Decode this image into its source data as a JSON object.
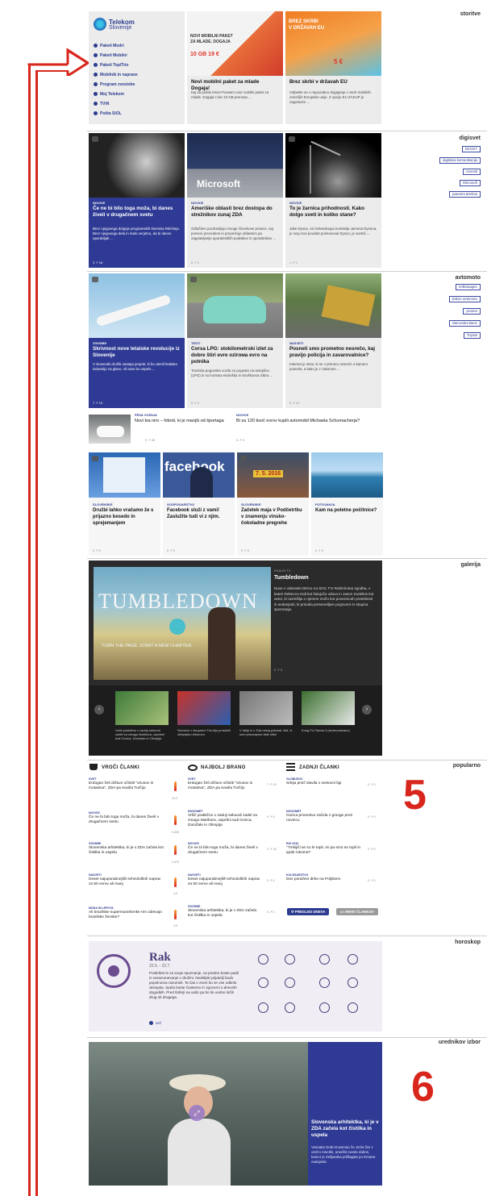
{
  "sections": {
    "storitve": "storitve",
    "digisvet": "digisvet",
    "avtomoto": "avtomoto",
    "galerija": "galerija",
    "popularno": "popularno",
    "horoskop": "horoskop",
    "urednikov": "urednikov izbor"
  },
  "telekom": {
    "brand1": "Telekom",
    "brand2": "Slovenije",
    "items": [
      "Paketi Modri",
      "Paketi Mobilni",
      "Paketi Top/Trio",
      "Mobilnik in naprave",
      "Program zvestobe",
      "Moj Telekom",
      "TViN",
      "Pošta SiOL"
    ]
  },
  "storitve_cards": [
    {
      "title": "Novi mobilni paket za mlade Dogaja!",
      "text": "Kaj sa pošite letos! Povsem novi mobilni paket za mlade. Dogaja s kar 10 GB prenosa ..."
    },
    {
      "title": "Brez skrbi v državah EU",
      "text": "Vsjbetite se v nepozabno dogajanje v vseh mobilnih omrežjih Evropske unije. Z opcijo EU ZAKUP je zagotovite ..."
    }
  ],
  "promo1": {
    "line1": "NOVI MOBILNI PAKET",
    "line2": "ZA MLADE. DOGAJA",
    "price": "10 GB 19 €"
  },
  "promo2": {
    "line1": "BREZ SKRBI",
    "line2": "V DRŽAVAH EU",
    "price": "5 €"
  },
  "digisvet_cards": [
    {
      "tag": "NOVICE",
      "title": "Če ne bi bilo toga moža, bi danes živeli v drugačnem svetu",
      "text": "Brez njegovega dolgoje programskih Dennisa Ritchieja. Brez njegovega dela in malo verjetno, da bi danes uporabljali ...",
      "stats": "3  ↗ 18"
    },
    {
      "tag": "NOVICE",
      "title": "Ameriške oblasti brez dostopa do strežnikov zunaj ZDA",
      "text": "Odločitev pozdravljajo mnoge človekove pravice, saj pomeni precedens in preprečuje oblastem pa zagotavljanje uporabniških podatkov iz uporabnikov ...",
      "stats": "0  ↗ 1"
    },
    {
      "tag": "NOVICE",
      "title": "To je žarnica prihodnosti. Kako dolgo sveti in koliko stane?",
      "text": "Jake Dyson, sin britanskega izumitelja Jamesa Dysona, je svoj novi produkt poimenoval Dyson, je svetnil ...",
      "stats": "1  ↗ 1"
    }
  ],
  "digisvet_tags": [
    "DIGGIT",
    "digitalna komunikacija",
    "novosti",
    "Microsoft",
    "pametni telefoni"
  ],
  "avtomoto_cards": [
    {
      "tag": "ZGODBE",
      "title": "Skrivnost nove letalske revolucije iz Slovenije",
      "text": "V slovenski družbi nastaja projekt, ki bo obrnil letalsko industrijo na glavo. Ali nam bo uspelo ...",
      "stats": "7  ↗ 13"
    },
    {
      "tag": "TESTI",
      "title": "Corsa LPG: stokilometrski izlet za dobre štiri evre ozirома evro na potnika",
      "text": "Tovrstna pogonska vozila so pogosto na avtoplinu (LPG) in so koristna ekološka in stroškovna izbira ...",
      "stats": "0  ↗ 4"
    },
    {
      "tag": "NASVETI",
      "title": "Posneli smo prometno nesrečo, kaj pravijo policija in zavarovalnice?",
      "text": "Internet je stvar, ki se v primeru nesreče s kamero posnela, a kako je z zakonom ...",
      "stats": "0  ↗ 10"
    }
  ],
  "avtomoto_tags": [
    "Volkswagen",
    "Zakon avtomoto",
    "promet",
    "Mercedes-Benz",
    "Toyota"
  ],
  "small_news": [
    {
      "tag": "PRVA VOŽNJA",
      "title": "Novi kia niro – hibrid, ki je manjši od športaga",
      "stats": "0  ↗ 45"
    },
    {
      "tag": "NOVICE",
      "title": "Bi za 120 tisoč evrov kupili avtomobil Michaela Schumacherja?",
      "stats": "0  ↗ 0"
    }
  ],
  "four_cards": [
    {
      "tag": "SLOVENSKE",
      "title": "Družbi lahko vračamo že s prijazno besedo in sprejemanjem",
      "stats": "0  ↗ 0"
    },
    {
      "tag": "GOSPODARSTVO",
      "title": "Facebook služi z vami! Zaslužite tudi vi z njim.",
      "stats": "0  ↗ 0"
    },
    {
      "tag": "SLOVENSKE",
      "title": "Začetek maja v Podčetrtku v znamenju vinsko-čokoladne pregrehe",
      "stats": "0  ↗ 0"
    },
    {
      "tag": "POTOVANJA",
      "title": "Kam na poletne počitnice?",
      "stats": "0  ↗ 0"
    }
  ],
  "card4_imgtext": "facebook",
  "card3_imgtext": "7. 5. 2016",
  "gallery": {
    "big_text": "TUMBLEDOWN",
    "sub": "TURN THE PAGE. START A NEW CHAPTER.",
    "tag": "FILM IN TV",
    "title": "Tumbledown",
    "text": "Nove v videoteki DKino na SiOL TV! Rahločutna zgodba, v kateri Rebecca Hall kot žalujoča vdova in Jason Sudeikis kot avtor, ki razmišlja o njenem možu kot poveznicah preteklosti in sedanjosti, ki prinaša presenetljive pogovore in skupna spoznanja.",
    "stats": "0  ↗ 0",
    "thumbs": [
      "Vršič praktično v zadnji sekundi zadel za zmago Maribora, uspešni tudi Gorica, Domžale in Olimpija",
      "Slovenci v skupnem Turnirju prosistili olimpijsko tekmovo",
      "V Italiji in v Zda nekaj policisti, tisti, ki smo pravzaprav tiste slike",
      "Kung Fu Panda 3 (sinhronizirano)"
    ]
  },
  "popular": {
    "col1_title": "VROČI ČLANKI",
    "col2_title": "NAJBOLJ BRANO",
    "col3_title": "ZADNJI ČLANKI",
    "big_number": "5",
    "col1": [
      {
        "tag": "SVET",
        "text": "Erdogan želi državo očistiti \"virusov in motastva\", ZDA pa svarila Turčijo",
        "n": "10.2"
      },
      {
        "tag": "NOVICE",
        "text": "Če ne bi bilo toga moža, bi danes živeli v drugačnem svetu",
        "n": "4,426"
      },
      {
        "tag": "ZGODBE",
        "text": "Slovenska arhitektka, ki je v ZDA začela kot čistilka in uspela",
        "n": "3,375"
      },
      {
        "tag": "NASVETI",
        "text": "Deset najuporabnejših tehnoloških naprav za 50 evrov ali manj",
        "n": "4,0"
      },
      {
        "tag": "MODA IN LEPOTA",
        "text": "Ali brazilske supermanekenke res odievajo brazilske ženske?",
        "n": "4,0"
      }
    ],
    "col2": [
      {
        "tag": "SVET",
        "text": "Erdogan želi državo očistiti \"virusov in motastva\", ZDA pa svarila Turčijo",
        "s": "7 ↗ 10"
      },
      {
        "tag": "NOGOMET",
        "text": "Vršič praktično v zadnji sekundi zadel za zmago Maribora, uspešni tudi Gorica, Domžale in Olimpija",
        "s": "0 ↗ 0"
      },
      {
        "tag": "NOVICE",
        "text": "Če ne bi bilo toga moža, bi danes živeli v drugačnem svetu",
        "s": "3 ↗ 18"
      },
      {
        "tag": "NASVETI",
        "text": "Deset najuporabnejših tehnoloških naprav za 50 evrov ali manj",
        "s": "0 ↗ 0"
      },
      {
        "tag": "ZGODBE",
        "text": "Slovenska arhitektka, ki je v ZDA začela kot čistilka in uspela",
        "s": "0 ↗ 0"
      }
    ],
    "col3": [
      {
        "tag": "GLOBUSOV",
        "text": "Srbija prvič slavila v svetovni ligi",
        "s": "0 ↗ 0"
      },
      {
        "tag": "NOGOMET",
        "text": "Gorica prvenstvo začela z gmoge proti novincu",
        "s": "0 ↗ 0"
      },
      {
        "tag": "RIO 2016",
        "text": "\"Tmkijiči se so le topli, mi pa smo se topli in igrali rokomet\"",
        "s": "0 ↗ 0"
      },
      {
        "tag": "KOLESARSTVO",
        "text": "Dez poraženi dirke na Poljskem",
        "s": "0 ↗ 0"
      }
    ],
    "btn_prev": "PREGLED DNEVA",
    "btn_archive": "ARHIV ČLANKOV"
  },
  "horoscope": {
    "sign": "Rak",
    "dates": "22.6. - 22.7.",
    "text": "Poskrbite le za svoje spoznanje, za preden boste padli in nerazumevanje v družini. Nedeljski prijatelji bodo popolnoma razumeli. Ta čas v zvezi bo se vse odkrito ukrepala. Spela boste čustveno in zgovorni o dnevnih dogodkih. Pred šoferji na vašo pa bo še vedno ločili drug ob drugega.",
    "more": "več"
  },
  "editor": {
    "title": "Slovenska arhitektka, ki je v ZDA začela kot čistilka in uspela",
    "text": "Vesnaka Drab-Gossman že 18 let živi v osrčni Ameriki, anerišti zveste dobrei, kamor je Zeiljanska prišlagala po Ereana vaanjavla.",
    "big_number": "6"
  },
  "colors": {
    "accent": "#2c3b8f",
    "red": "#d8261c",
    "dark": "#2b2b2b"
  }
}
